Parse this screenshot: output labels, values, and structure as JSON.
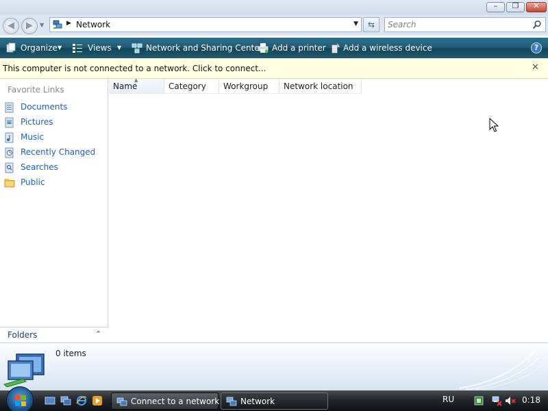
{
  "window": {
    "title_buttons": {
      "minimize_glyph": "–",
      "maximize_glyph": "❐",
      "close_glyph": "✕"
    }
  },
  "address": {
    "location": "Network",
    "search_placeholder": "Search"
  },
  "toolbar": {
    "organize": "Organize",
    "views": "Views",
    "network_sharing_center": "Network and Sharing Center",
    "add_printer": "Add a printer",
    "add_wireless_device": "Add a wireless device",
    "help_glyph": "?"
  },
  "infobar": {
    "message": "This computer is not connected to a network. Click to connect...",
    "close_glyph": "✕"
  },
  "navpane": {
    "heading": "Favorite Links",
    "links": [
      {
        "label": "Documents",
        "icon": "documents-icon"
      },
      {
        "label": "Pictures",
        "icon": "pictures-icon"
      },
      {
        "label": "Music",
        "icon": "music-icon"
      },
      {
        "label": "Recently Changed",
        "icon": "recently-changed-icon"
      },
      {
        "label": "Searches",
        "icon": "searches-icon"
      },
      {
        "label": "Public",
        "icon": "public-folder-icon"
      }
    ],
    "folders_label": "Folders"
  },
  "filelist": {
    "columns": [
      "Name",
      "Category",
      "Workgroup",
      "Network location"
    ]
  },
  "details": {
    "items_count": "0 items"
  },
  "taskbar": {
    "tasks": [
      {
        "label": "Connect to a network"
      },
      {
        "label": "Network"
      }
    ],
    "language": "RU",
    "clock": "0:18"
  },
  "colors": {
    "toolbar": "#215a75",
    "infobar": "#ffffe1",
    "link": "#1d5fb8",
    "taskbar": "#23272c"
  }
}
